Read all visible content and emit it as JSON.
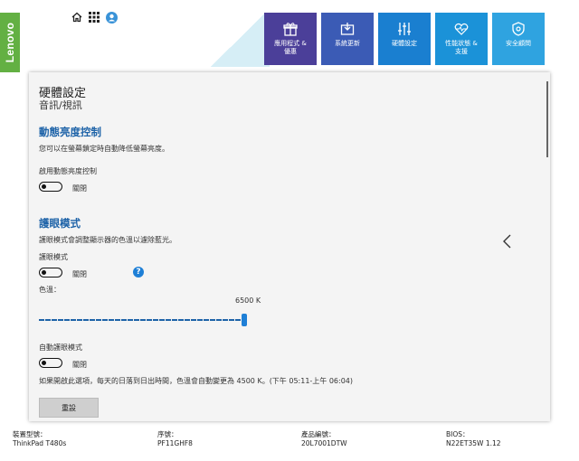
{
  "brand": "Lenovo",
  "top_icons": [
    "home-icon",
    "grid-icon",
    "user-icon"
  ],
  "tiles": [
    {
      "label": "應用程式 &\n優惠",
      "icon": "gift-icon",
      "color": "#4b3f99"
    },
    {
      "label": "系統更新",
      "icon": "update-icon",
      "color": "#3b5bb5"
    },
    {
      "label": "硬體設定",
      "icon": "sliders-icon",
      "color": "#1a7fd0"
    },
    {
      "label": "性能狀態 &\n支援",
      "icon": "heart-pulse-icon",
      "color": "#1b92d8"
    },
    {
      "label": "安全顧問",
      "icon": "shield-icon",
      "color": "#2fa3e0"
    }
  ],
  "page": {
    "title": "硬體設定",
    "subtitle": "音訊/視訊"
  },
  "dynamic_brightness": {
    "heading": "動態亮度控制",
    "description": "您可以在螢幕鎖定時自動降低螢幕亮度。",
    "toggle_label": "啟用動態亮度控制",
    "toggle_state": "關閉"
  },
  "eye_care": {
    "heading": "護眼模式",
    "description": "護眼模式會調整顯示器的色溫以濾除藍光。",
    "toggle_label": "護眼模式",
    "toggle_state": "關閉",
    "help": "?",
    "temp_label": "色溫：",
    "temp_value": "6500 K",
    "auto_label": "自動護眼模式",
    "auto_state": "關閉",
    "auto_description": "如果開啟此選項，每天的日落到日出時間，色溫會自動變更為 4500 K。(下午 05:11-上午 06:04)",
    "reset_label": "重設"
  },
  "footer": {
    "model_label": "裝置型號：",
    "model_value": "ThinkPad T480s",
    "serial_label": "序號：",
    "serial_value": "PF11GHF8",
    "product_label": "產品編號：",
    "product_value": "20L7001DTW",
    "bios_label": "BIOS：",
    "bios_value": "N22ET35W 1.12"
  }
}
